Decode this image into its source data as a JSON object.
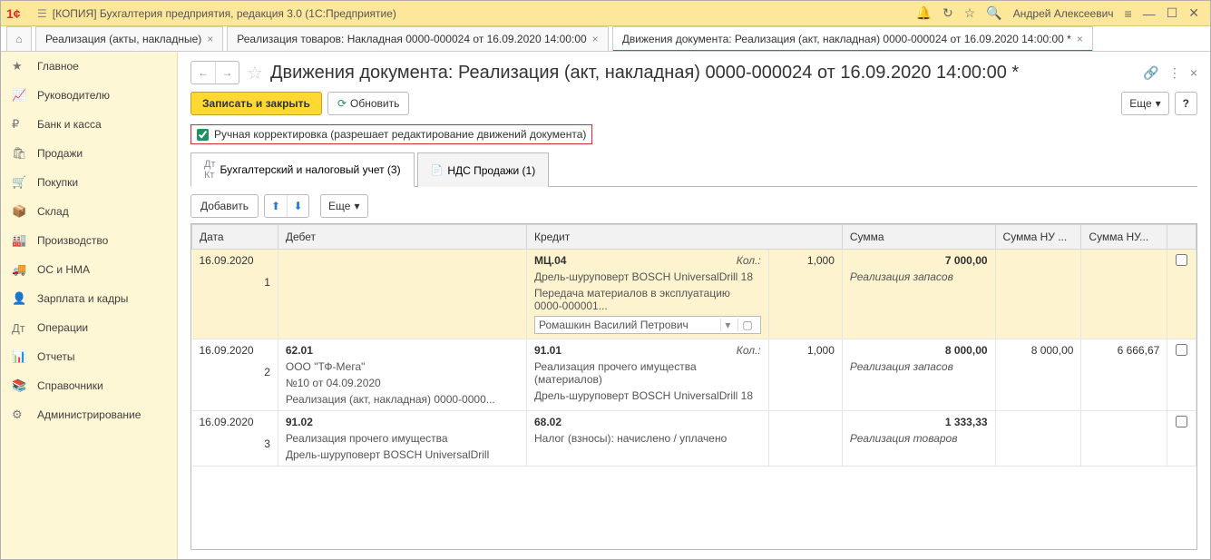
{
  "titlebar": {
    "title": "[КОПИЯ] Бухгалтерия предприятия, редакция 3.0  (1С:Предприятие)",
    "user": "Андрей Алексеевич"
  },
  "tabs": [
    {
      "label": "Реализация (акты, накладные)"
    },
    {
      "label": "Реализация товаров: Накладная 0000-000024 от 16.09.2020 14:00:00"
    },
    {
      "label": "Движения документа: Реализация (акт, накладная) 0000-000024 от 16.09.2020 14:00:00 *"
    }
  ],
  "sidebar": [
    {
      "icon": "★",
      "label": "Главное"
    },
    {
      "icon": "📈",
      "label": "Руководителю"
    },
    {
      "icon": "₽",
      "label": "Банк и касса"
    },
    {
      "icon": "🛍",
      "label": "Продажи"
    },
    {
      "icon": "🛒",
      "label": "Покупки"
    },
    {
      "icon": "📦",
      "label": "Склад"
    },
    {
      "icon": "🏭",
      "label": "Производство"
    },
    {
      "icon": "🚚",
      "label": "ОС и НМА"
    },
    {
      "icon": "👤",
      "label": "Зарплата и кадры"
    },
    {
      "icon": "Дт",
      "label": "Операции"
    },
    {
      "icon": "📊",
      "label": "Отчеты"
    },
    {
      "icon": "📚",
      "label": "Справочники"
    },
    {
      "icon": "⚙",
      "label": "Администрирование"
    }
  ],
  "page": {
    "title": "Движения документа: Реализация (акт, накладная) 0000-000024 от 16.09.2020 14:00:00 *",
    "save_close": "Записать и закрыть",
    "refresh": "Обновить",
    "more": "Еще",
    "help": "?",
    "manual_edit": "Ручная корректировка (разрешает редактирование движений документа)",
    "subtab1": "Бухгалтерский и налоговый учет (3)",
    "subtab2": "НДС Продажи (1)",
    "add": "Добавить"
  },
  "gridHeaders": {
    "date": "Дата",
    "debit": "Дебет",
    "credit": "Кредит",
    "sum": "Сумма",
    "sum_nu_dt": "Сумма НУ ...",
    "sum_nu_kt": "Сумма НУ..."
  },
  "rows": [
    {
      "cls": "row-yellow",
      "date": "16.09.2020",
      "n": "1",
      "debit_acc": "",
      "debit_lines": [],
      "credit_acc": "МЦ.04",
      "credit_kol_label": "Кол.:",
      "credit_kol": "1,000",
      "credit_lines": [
        "Дрель-шуруповерт BOSCH UniversalDrill 18",
        "Передача материалов в эксплуатацию 0000-000001..."
      ],
      "credit_input": "Ромашкин Василий Петрович",
      "sum": "7 000,00",
      "sum_nu_dt": "",
      "sum_nu_kt": "",
      "desc": "Реализация запасов"
    },
    {
      "cls": "",
      "date": "16.09.2020",
      "n": "2",
      "debit_acc": "62.01",
      "debit_lines": [
        "ООО \"ТФ-Мега\"",
        "№10 от 04.09.2020",
        "Реализация (акт, накладная) 0000-0000..."
      ],
      "credit_acc": "91.01",
      "credit_kol_label": "Кол.:",
      "credit_kol": "1,000",
      "credit_lines": [
        "Реализация прочего имущества (материалов)",
        "Дрель-шуруповерт BOSCH UniversalDrill 18"
      ],
      "sum": "8 000,00",
      "sum_nu_dt": "8 000,00",
      "sum_nu_kt": "6 666,67",
      "desc": "Реализация запасов"
    },
    {
      "cls": "",
      "date": "16.09.2020",
      "n": "3",
      "debit_acc": "91.02",
      "debit_lines": [
        "Реализация прочего имущества",
        "Дрель-шуруповерт BOSCH UniversalDrill"
      ],
      "credit_acc": "68.02",
      "credit_kol_label": "",
      "credit_kol": "",
      "credit_lines": [
        "Налог (взносы): начислено / уплачено"
      ],
      "sum": "1 333,33",
      "sum_nu_dt": "",
      "sum_nu_kt": "",
      "desc": "Реализация товаров"
    }
  ]
}
